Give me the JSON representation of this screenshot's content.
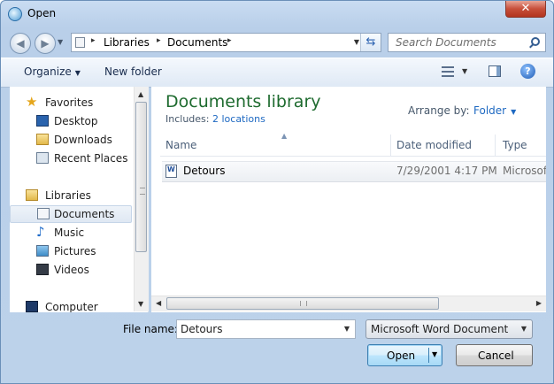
{
  "window": {
    "title": "Open",
    "close_label": "✕"
  },
  "address": {
    "crumbs": [
      "Libraries",
      "Documents"
    ],
    "separator": "▸"
  },
  "search": {
    "placeholder": "Search Documents"
  },
  "toolbar": {
    "organize": "Organize",
    "new_folder": "New folder",
    "help": "?"
  },
  "nav": {
    "favorites": "Favorites",
    "desktop": "Desktop",
    "downloads": "Downloads",
    "recent": "Recent Places",
    "libraries": "Libraries",
    "documents": "Documents",
    "music": "Music",
    "pictures": "Pictures",
    "videos": "Videos",
    "computer": "Computer"
  },
  "content": {
    "title": "Documents library",
    "includes_label": "Includes:",
    "includes_link": "2 locations",
    "arrange_label": "Arrange by:",
    "arrange_value": "Folder",
    "columns": {
      "name": "Name",
      "date": "Date modified",
      "type": "Type"
    },
    "files": [
      {
        "name": "Detours",
        "date": "7/29/2001 4:17 PM",
        "type": "Microsoft"
      }
    ]
  },
  "bottom": {
    "file_name_label": "File name:",
    "file_name_value": "Detours",
    "file_type_value": "Microsoft Word Document (*.d",
    "open_label": "Open",
    "cancel_label": "Cancel"
  },
  "colors": {
    "accent": "#1e69c2",
    "title_green": "#1e395b",
    "close_red": "#c74f3a"
  }
}
